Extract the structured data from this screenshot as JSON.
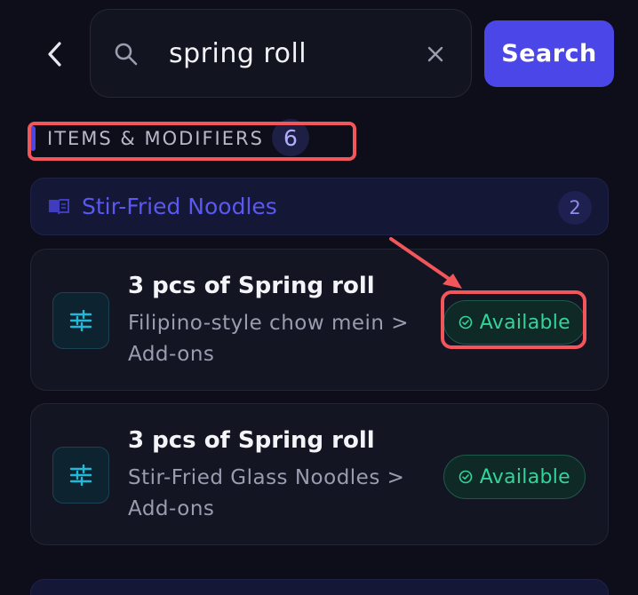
{
  "search": {
    "value": "spring roll",
    "button_label": "Search"
  },
  "section": {
    "title": "ITEMS & MODIFIERS",
    "count": "6"
  },
  "group": {
    "title": "Stir-Fried Noodles",
    "count": "2"
  },
  "items": [
    {
      "name": "3 pcs of Spring roll",
      "path": "Filipino-style chow mein  >  Add-ons",
      "status": "Available"
    },
    {
      "name": "3 pcs of Spring roll",
      "path": "Stir-Fried Glass Noodles  >  Add-ons",
      "status": "Available"
    }
  ],
  "colors": {
    "accent": "#4a46e8",
    "available": "#34d399",
    "annotation": "#f2555a"
  },
  "icons": {
    "back": "chevron-left-icon",
    "search": "search-icon",
    "clear": "close-icon",
    "group": "book-icon",
    "modifier": "sliders-icon",
    "status": "check-circle-icon"
  }
}
